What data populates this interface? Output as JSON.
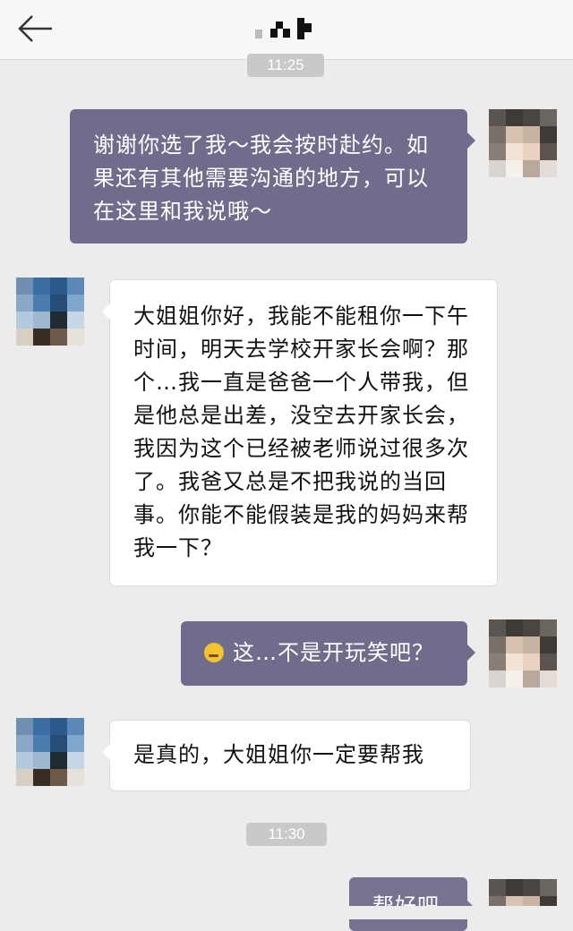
{
  "header": {
    "back_icon": "arrow-left-icon",
    "contact_name_pixelated": true
  },
  "timestamps": [
    "11:25",
    "11:30"
  ],
  "messages": [
    {
      "side": "out",
      "text": "谢谢你选了我～我会按时赴约。如果还有其他需要沟通的地方，可以在这里和我说哦～"
    },
    {
      "side": "in",
      "text": "大姐姐你好，我能不能租你一下午时间，明天去学校开家长会啊？那个…我一直是爸爸一个人带我，但是他总是出差，没空去开家长会，我因为这个已经被老师说过很多次了。我爸又总是不把我说的当回事。你能不能假装是我的妈妈来帮我一下？"
    },
    {
      "side": "out",
      "emoji": "cold-sweat-emoji",
      "text": "这…不是开玩笑吧？"
    },
    {
      "side": "in",
      "text": "是真的，大姐姐你一定要帮我"
    },
    {
      "side": "out",
      "text": "帮好吧"
    }
  ],
  "colors": {
    "outgoing_bubble": "#6f6d8b",
    "incoming_bubble": "#ffffff",
    "background": "#ececec"
  }
}
